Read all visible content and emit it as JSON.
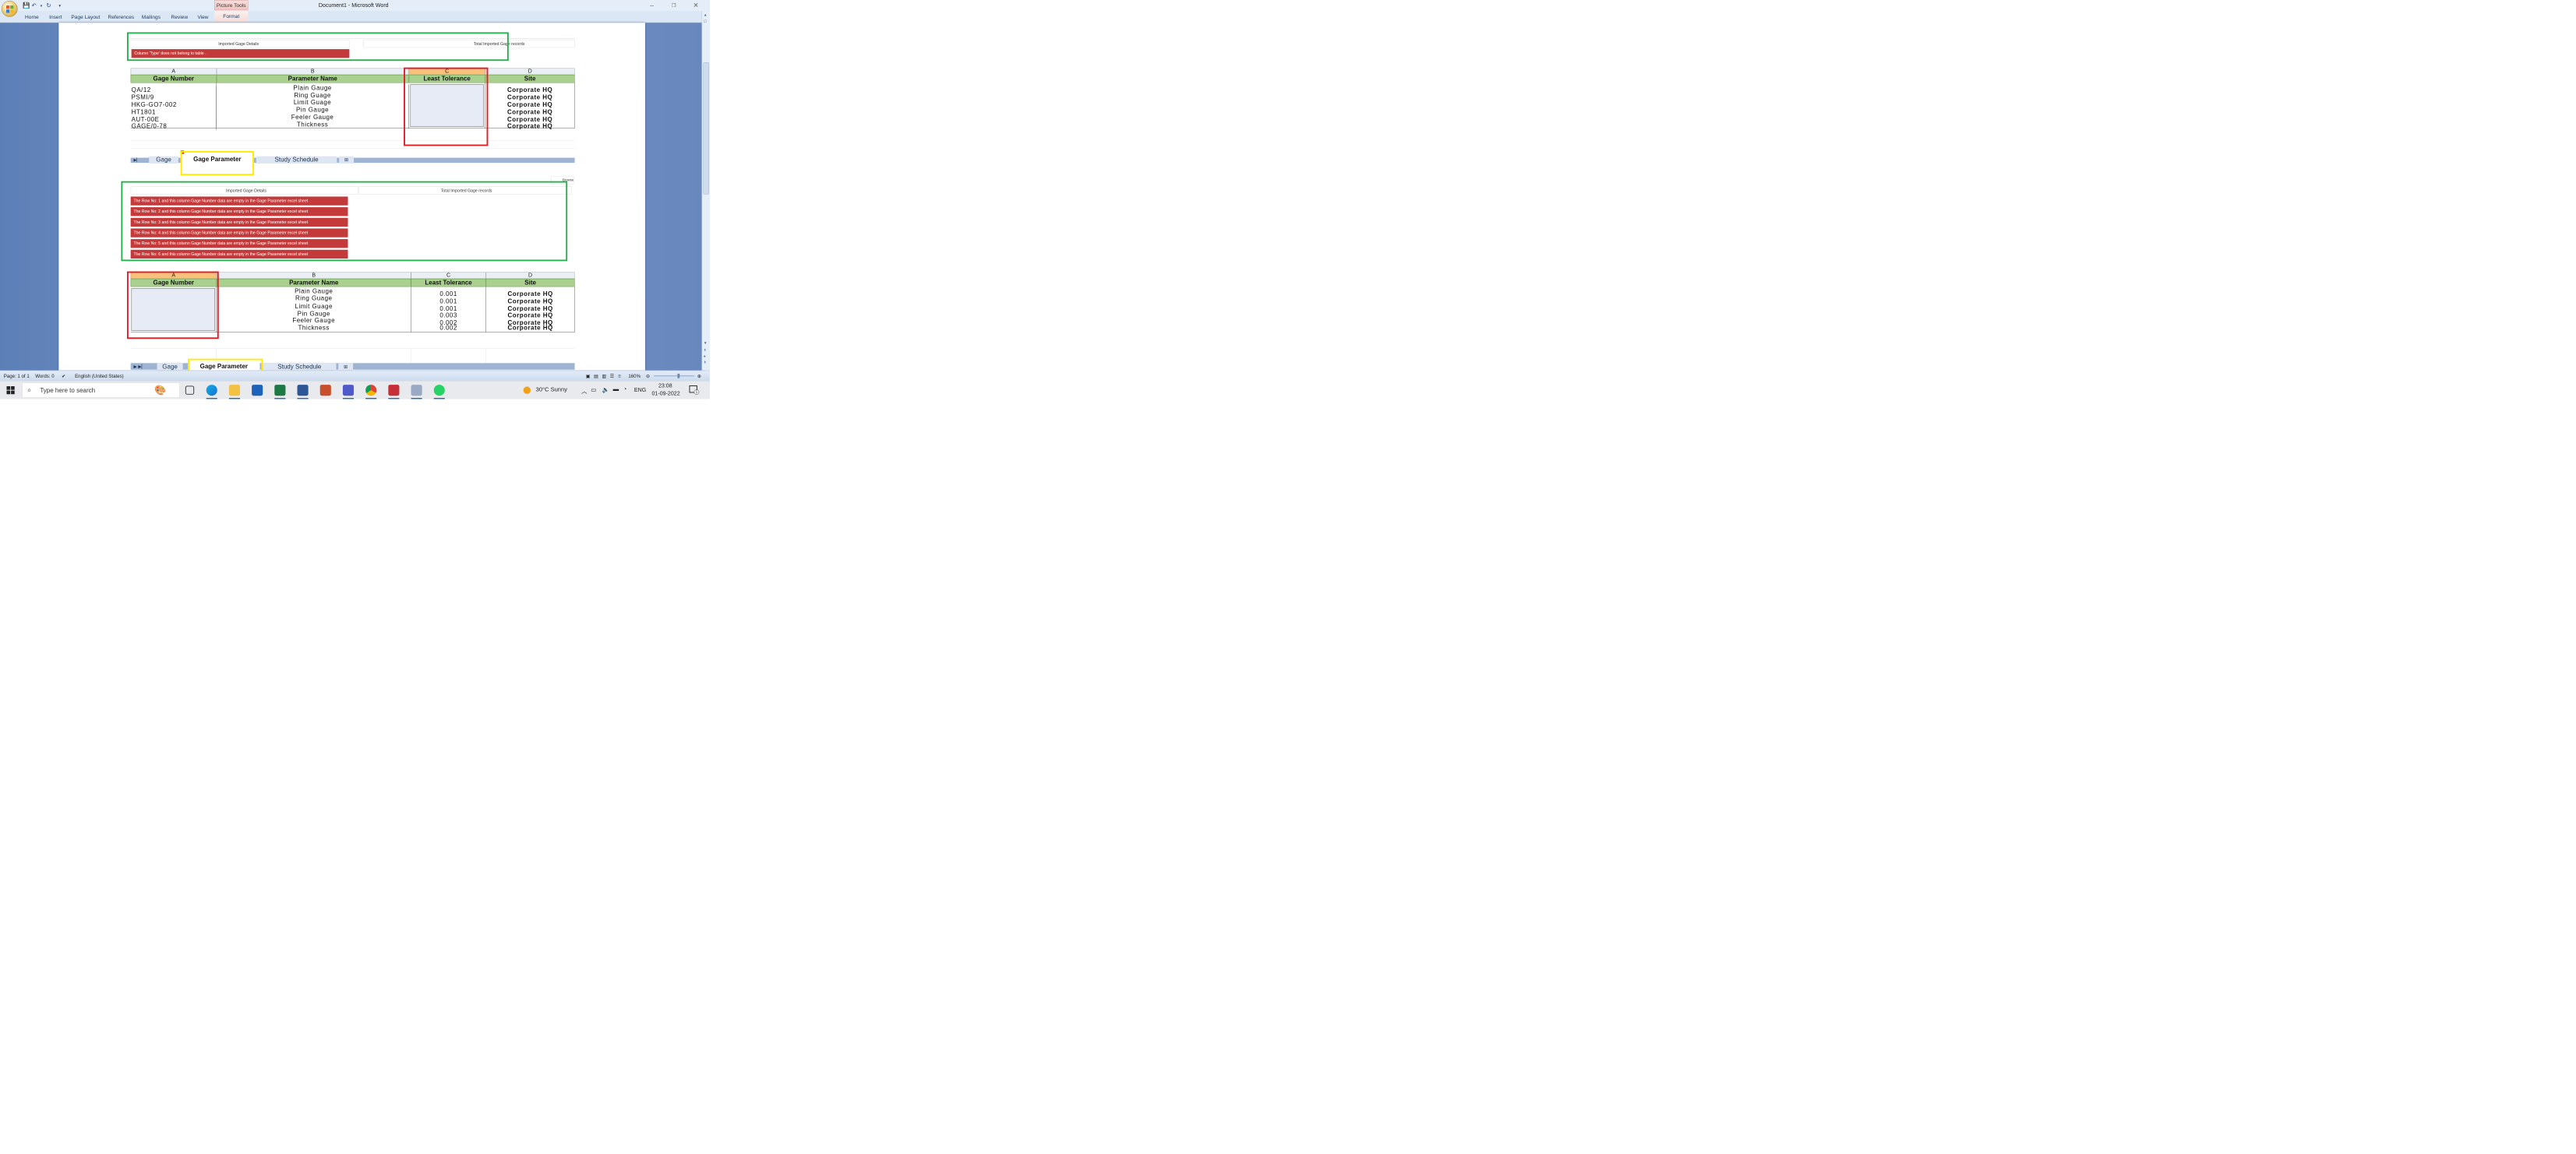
{
  "window": {
    "title": "Document1 - Microsoft Word",
    "contextual_tab": "Picture Tools",
    "controls": [
      "–",
      "❐",
      "✕"
    ]
  },
  "ribbon": {
    "tabs": [
      "Home",
      "Insert",
      "Page Layout",
      "References",
      "Mailings",
      "Review",
      "View",
      "Format"
    ]
  },
  "image1": {
    "header_left": "Imported Gage Details",
    "header_right": "Total Imported Gage records",
    "error": "Column 'Type' does not belong to table .",
    "column_letters": [
      "A",
      "B",
      "C",
      "D"
    ],
    "headers": [
      "Gage Number",
      "Parameter Name",
      "Least Tolerance",
      "Site"
    ],
    "rows": [
      [
        "QA/12",
        "Plain Gauge",
        "",
        "Corporate HQ"
      ],
      [
        "PSMI/9",
        "Ring Guage",
        "",
        "Corporate HQ"
      ],
      [
        "HKG-GO7-002",
        "Limit Guage",
        "",
        "Corporate HQ"
      ],
      [
        "HT1801",
        "Pin Gauge",
        "",
        "Corporate HQ"
      ],
      [
        "AUT-00E",
        "Feeler Gauge",
        "",
        "Corporate HQ"
      ],
      [
        "GAGE/0-78",
        "Thickness",
        "",
        "Corporate HQ"
      ]
    ],
    "sheet_tabs": [
      "Gage",
      "Gage Parameter",
      "Study Schedule"
    ]
  },
  "image2": {
    "header_left": "Imported Gage Details",
    "header_right": "Total Imported Gage records",
    "corner_text": "Browse",
    "errors": [
      "The Row No: 1 and this column Gage Number data are empty in the Gage Parameter excel sheet",
      "The Row No: 2 and this column Gage Number data are empty in the Gage Parameter excel sheet",
      "The Row No: 3 and this column Gage Number data are empty in the Gage Parameter excel sheet",
      "The Row No: 4 and this column Gage Number data are empty in the Gage Parameter excel sheet",
      "The Row No: 5 and this column Gage Number data are empty in the Gage Parameter excel sheet",
      "The Row No: 6 and this column Gage Number data are empty in the Gage Parameter excel sheet"
    ]
  },
  "image3": {
    "column_letters": [
      "A",
      "B",
      "C",
      "D"
    ],
    "headers": [
      "Gage Number",
      "Parameter Name",
      "Least Tolerance",
      "Site"
    ],
    "rows": [
      [
        "",
        "Plain Gauge",
        "0.001",
        "Corporate HQ"
      ],
      [
        "",
        "Ring Guage",
        "0.001",
        "Corporate HQ"
      ],
      [
        "",
        "Limit Guage",
        "0.001",
        "Corporate HQ"
      ],
      [
        "",
        "Pin Gauge",
        "0.003",
        "Corporate HQ"
      ],
      [
        "",
        "Feeler Gauge",
        "0.002",
        "Corporate HQ"
      ],
      [
        "",
        "Thickness",
        "0.002",
        "Corporate HQ"
      ]
    ],
    "sheet_tabs": [
      "Gage",
      "Gage Parameter",
      "Study Schedule"
    ]
  },
  "status": {
    "page": "Page: 1 of 1",
    "words": "Words: 0",
    "language": "English (United States)",
    "zoom": "160%"
  },
  "taskbar": {
    "search_placeholder": "Type here to search",
    "weather": "30°C  Sunny",
    "lang": "ENG",
    "time": "23:08",
    "date": "01-09-2022",
    "notifications": "1"
  }
}
